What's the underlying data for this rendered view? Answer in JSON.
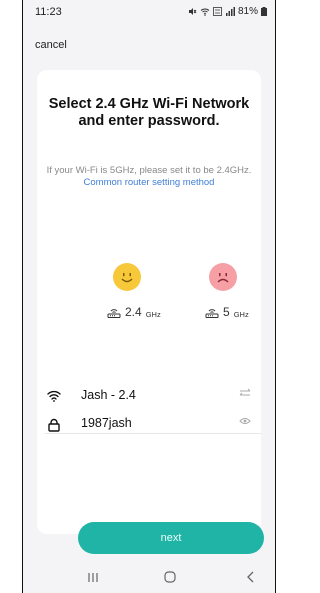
{
  "status_bar": {
    "time": "11:23",
    "battery": "81%",
    "icons": [
      "mute-icon",
      "wifi-signal-icon",
      "volte-lte-icon",
      "cell-signal-icon",
      "battery-icon"
    ]
  },
  "topbar": {
    "cancel_label": "cancel"
  },
  "setup": {
    "title": "Select 2.4 GHz Wi-Fi Network and enter password.",
    "hint_text": "If your Wi-Fi is 5GHz, please set it to be 2.4GHz.",
    "hint_link": "Common router setting method",
    "band_options": [
      {
        "value": "2.4",
        "unit": "GHz",
        "face": "happy-face-icon",
        "color": "#f7c93a"
      },
      {
        "value": "5",
        "unit": "GHz",
        "face": "sad-face-icon",
        "color": "#f6a0a6"
      }
    ],
    "network": {
      "ssid": "Jash - 2.4",
      "icon": "wifi-icon",
      "action_icon": "swap-network-icon"
    },
    "password": {
      "value": "1987jash",
      "icon": "lock-icon",
      "action_icon": "eye-icon"
    },
    "next_label": "next"
  },
  "navigation": {
    "icons": [
      "recent-apps-icon",
      "home-icon",
      "back-icon"
    ]
  },
  "colors": {
    "accent": "#1fb4a6",
    "link": "#3f7fd6",
    "background": "#f4f4f6"
  }
}
